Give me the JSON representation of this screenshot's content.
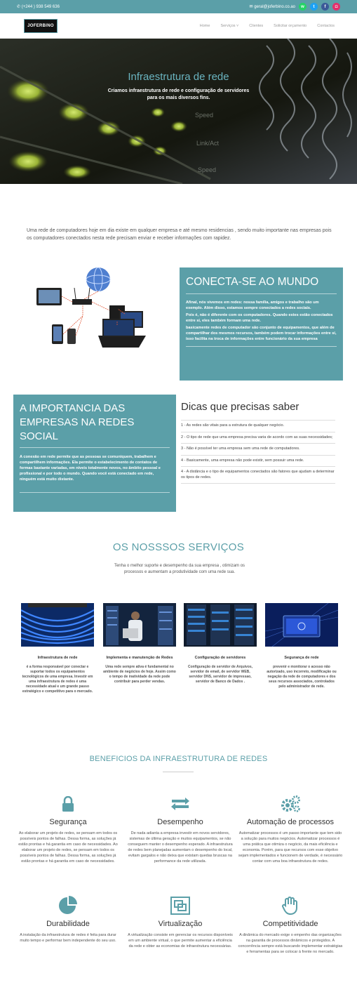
{
  "topbar": {
    "phone": "(+244 ) 938 549 636",
    "email": "geral@joferbino.co.ao",
    "social": [
      {
        "name": "whatsapp-icon",
        "glyph": "w",
        "color": "#25d366"
      },
      {
        "name": "twitter-icon",
        "glyph": "t",
        "color": "#1da1f2"
      },
      {
        "name": "facebook-icon",
        "glyph": "f",
        "color": "#3b5998"
      },
      {
        "name": "instagram-icon",
        "glyph": "◘",
        "color": "#e1306c"
      }
    ]
  },
  "nav": {
    "logo": "JOFERBINO",
    "items": [
      "Home",
      "Serviços ˅",
      "Clientes",
      "Solicitar orçamento",
      "Contactos"
    ]
  },
  "hero": {
    "title": "Infraestrutura de rede",
    "subtitle": "Criamos infraestrutura de rede e configuração de servidores para os mais diversos fins."
  },
  "intro": "Uma rede de computadores hoje em dia existe em qualquer empresa e até mesmo residencias , sendo muito importante nas empresas pois os computadores conectados nesta rede precisam enviar e receber informações com rapidez.",
  "connect": {
    "title": "CONECTA-SE AO MUNDO",
    "p1": "Afinal, nós vivemos em redes: nossa família, amigos e trabalho são um exemplo. Além disso, estamos sempre conectados a redes sociais.",
    "p2": "Pois é, não é diferente com os computadores. Quando estes estão conectados entre si, eles também formam uma rede.",
    "p3": "basicamente redes de computador são conjunto de equipamentos, que além de compartilhar dos mesmos recursos, também podem trocar informações entre si, isso facilita na troca de informações entre funcionário da sua empresa"
  },
  "importance": {
    "title": "A IMPORTANCIA DAS EMPRESAS NA REDES SOCIAL",
    "body": "A conexão em rede permite que as pessoas se comuniquem, trabalhem e compartilhem informações. Ela permite o estabelecimento de contatos de formas bastante variadas, em níveis totalmente novos, no âmbito pessoal e profissional e por todo o mundo. Quando você está conectado em rede, ninguém está muito distante."
  },
  "tips": {
    "title": "Dicas que precisas saber",
    "items": [
      "1 - As redes são vitais para a estrutura de qualquer negócio.",
      "2 - O tipo de rede que uma empresa precisa varia de acordo com as suas necessidades;",
      "3 - Não é possível ter uma empresa sem uma rede de computadores.",
      "4 - Basicamente, uma empresa não pode existir, sem possuir uma rede.",
      "4 - A distância e o tipo de equipamentos conectados são fatores que ajudam a determinar os tipos de redes."
    ]
  },
  "services": {
    "title": "OS NOSSSOS SERVIÇOS",
    "subtitle": "Tenha o melhor suporte e desempenho da sua empresa , otimizam os processos e aumentam a produtividade com uma rede sua.",
    "cards": [
      {
        "title": "Infraestrutura de rede",
        "text": "é a forma responsável por conectar e suportar todos os equipamentos tecnológicos de uma empresa. Investir em uma infraestrutura de redes é uma necessidade atual e um grande passo estratégico e competitivo para o mercado."
      },
      {
        "title": "Implementa e manutenção de Redes",
        "text": "Uma rede sempre ativa é fundamental no ambiente de negócios de hoje. Assim como o tempo de inatividade da rede pode contribuir para perder vendas."
      },
      {
        "title": "Configuração de servidores",
        "text": "Configuração de servidor de Arquivos, servidor de email, de servidor WEB, servidor DNS, servidor de impressao, servidor de Banco de Dados ."
      },
      {
        "title": "Segurança de rede",
        "text": "prevenir e monitorar o acesso não autorizado, uso incorreto, modificação ou negação da rede de computadores e dos seus recursos associados, controlados pelo administrador de rede."
      }
    ]
  },
  "benefits": {
    "title": "BENEFICIOS DA INFRAESTRUTURA DE REDES",
    "items": [
      {
        "icon": "lock-icon",
        "title": "Segurança",
        "text": "Ao elaborar um projeto de redes, se pensam em todos os possíveis pontos de falhas. Dessa forma, as soluções já estão prontas e há garantia em caso de necessidades. Ao elaborar um projeto de redes, se pensam em todos os possíveis pontos de falhas. Dessa forma, as soluções já estão prontas e há garantia em caso de necessidades."
      },
      {
        "icon": "retweet-icon",
        "title": "Desempenho",
        "text": "De nada adianta a empresa investir em novos servidores, sistemas de última geração e muitos equipamentos, se não conseguem manter o desempenho esperado. A infraestrutura de redes bem planejadas aumentam o desempenho do local, evitam gargalos e não deixa que existam quedas bruscas na performance da rede utilizada."
      },
      {
        "icon": "gears-icon",
        "title": "Automação de processos",
        "text": "Automatizar processos é um passo importante que tem sido a solução para muitos negócios. Automatizar processos é uma prática que otimiza o negócio, da mais eficiência e economia. Porém, para que recursos com esse objetivo sejam implementados e funcionem de verdade, é necessário contar com uma boa infraestrutura de redes."
      },
      {
        "icon": "pie-chart-icon",
        "title": "Durabilidade",
        "text": "A instalação da infraestrutura de redes é feita para durar muito tempo e performar bem independente do seu uso."
      },
      {
        "icon": "virtualization-icon",
        "title": "Virtualização",
        "text": "A virtualização consiste em gerenciar os recursos disponíveis em um ambiente virtual, o que permite aumentar a eficiência da rede e obter as economias de infraestrutura necessárias."
      },
      {
        "icon": "hand-icon",
        "title": "Competitividade",
        "text": "A dinâmica do mercado exige o empenho das organizações na garantia de processos dinâmicos e protegidos. A concorrência sempre está buscando implementar estratégias e ferramentas para se colocar à frente no mercado."
      }
    ]
  },
  "colors": {
    "accent": "#5b9fa8"
  }
}
